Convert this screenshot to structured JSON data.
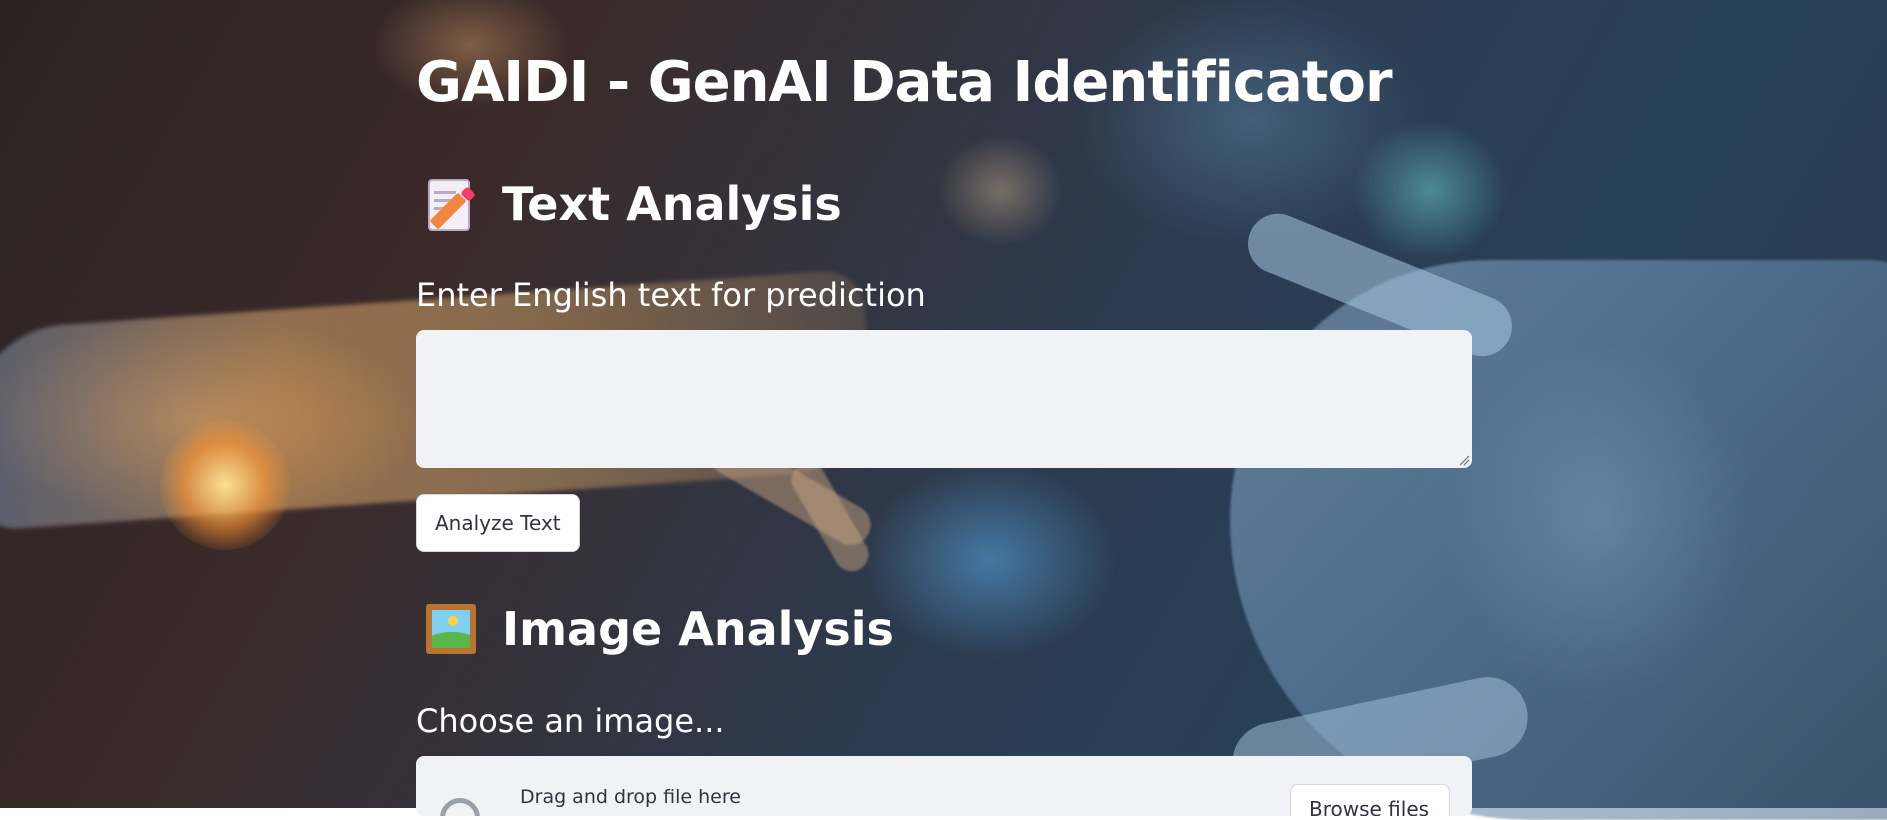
{
  "page": {
    "title": "GAIDI - GenAI Data Identificator",
    "background_icon": "ai-hand-touch-background"
  },
  "text_section": {
    "icon": "memo-icon",
    "heading": "Text Analysis",
    "input_label": "Enter English text for prediction",
    "input_value": "",
    "input_placeholder": "",
    "button_label": "Analyze Text"
  },
  "image_section": {
    "icon": "framed-picture-icon",
    "heading": "Image Analysis",
    "uploader_label": "Choose an image...",
    "drop_text": "Drag and drop file here",
    "browse_label": "Browse files"
  },
  "colors": {
    "heading_text": "#ffffff",
    "input_bg": "#f0f2f6",
    "button_bg": "#ffffff",
    "button_text": "#31333f"
  }
}
